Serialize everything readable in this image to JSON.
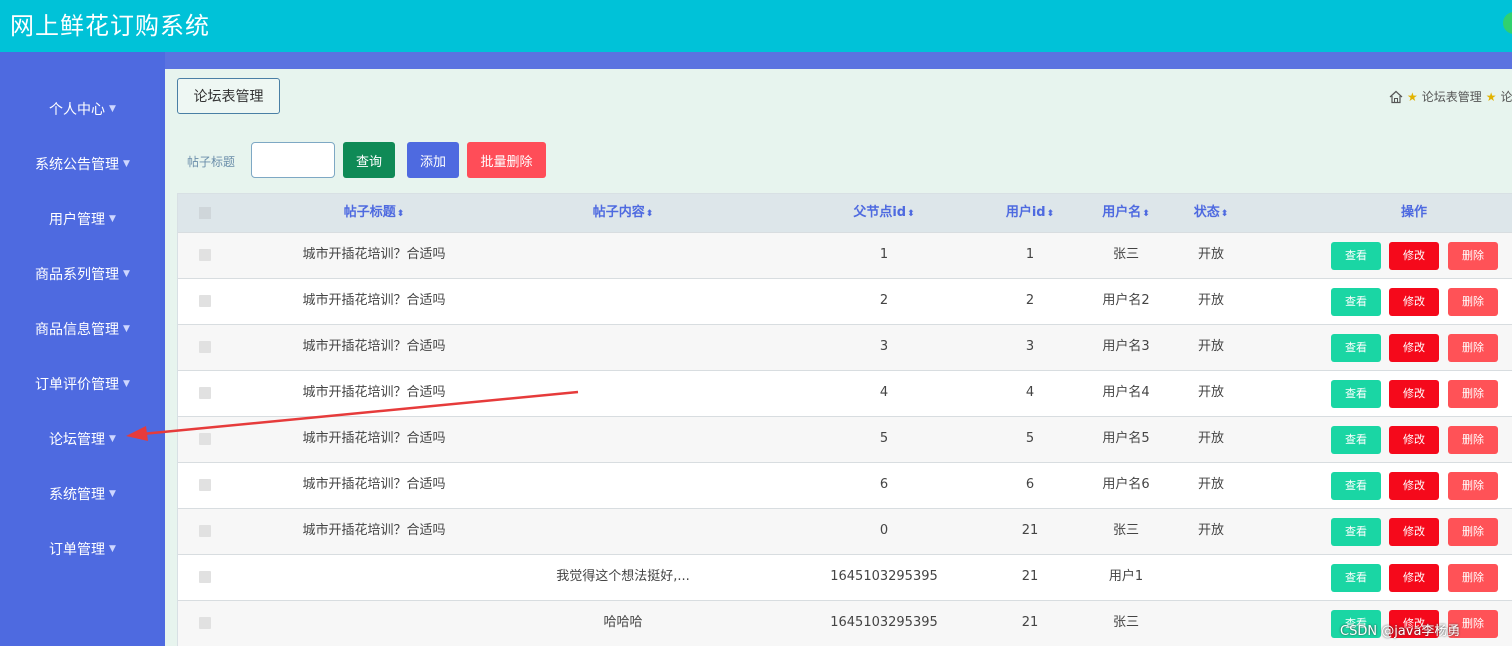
{
  "app": {
    "title": "网上鲜花订购系统"
  },
  "sidebar": {
    "items": [
      {
        "label": "个人中心"
      },
      {
        "label": "系统公告管理"
      },
      {
        "label": "用户管理"
      },
      {
        "label": "商品系列管理"
      },
      {
        "label": "商品信息管理"
      },
      {
        "label": "订单评价管理"
      },
      {
        "label": "论坛管理"
      },
      {
        "label": "系统管理"
      },
      {
        "label": "订单管理"
      }
    ],
    "caret": "▼"
  },
  "tab": {
    "label": "论坛表管理"
  },
  "breadcrumb": {
    "current": "论坛表管理",
    "next": "论"
  },
  "search": {
    "label": "帖子标题",
    "value": "",
    "placeholder": ""
  },
  "buttons": {
    "query": "查询",
    "add": "添加",
    "batch_delete": "批量删除"
  },
  "table": {
    "sort_icon": "⬍",
    "columns": [
      "帖子标题",
      "帖子内容",
      "父节点id",
      "用户id",
      "用户名",
      "状态",
      "操作"
    ],
    "actions": {
      "view": "查看",
      "edit": "修改",
      "delete": "删除"
    },
    "rows": [
      {
        "title": "城市开插花培训？合适吗",
        "content": "",
        "parent_id": "1",
        "user_id": "1",
        "username": "张三",
        "status": "开放"
      },
      {
        "title": "城市开插花培训？合适吗",
        "content": "",
        "parent_id": "2",
        "user_id": "2",
        "username": "用户名2",
        "status": "开放"
      },
      {
        "title": "城市开插花培训？合适吗",
        "content": "",
        "parent_id": "3",
        "user_id": "3",
        "username": "用户名3",
        "status": "开放"
      },
      {
        "title": "城市开插花培训？合适吗",
        "content": "",
        "parent_id": "4",
        "user_id": "4",
        "username": "用户名4",
        "status": "开放"
      },
      {
        "title": "城市开插花培训？合适吗",
        "content": "",
        "parent_id": "5",
        "user_id": "5",
        "username": "用户名5",
        "status": "开放"
      },
      {
        "title": "城市开插花培训？合适吗",
        "content": "",
        "parent_id": "6",
        "user_id": "6",
        "username": "用户名6",
        "status": "开放"
      },
      {
        "title": "城市开插花培训？合适吗",
        "content": "",
        "parent_id": "0",
        "user_id": "21",
        "username": "张三",
        "status": "开放"
      },
      {
        "title": "",
        "content": "我觉得这个想法挺好,...",
        "parent_id": "1645103295395",
        "user_id": "21",
        "username": "用户1",
        "status": ""
      },
      {
        "title": "",
        "content": "哈哈哈",
        "parent_id": "1645103295395",
        "user_id": "21",
        "username": "张三",
        "status": ""
      }
    ]
  },
  "watermark": "CSDN @java李杨勇",
  "colors": {
    "topbar": "#00c2d8",
    "sidebar": "#4e6ae0",
    "content_bg": "#e7f4ee",
    "query_btn": "#0f8a56",
    "add_btn": "#4e6ae0",
    "batch_btn": "#ff4d58",
    "view_btn": "#1ad6a4",
    "edit_btn": "#f5091b",
    "delete_btn": "#ff5257",
    "annotation_arrow": "#e63b3b"
  }
}
